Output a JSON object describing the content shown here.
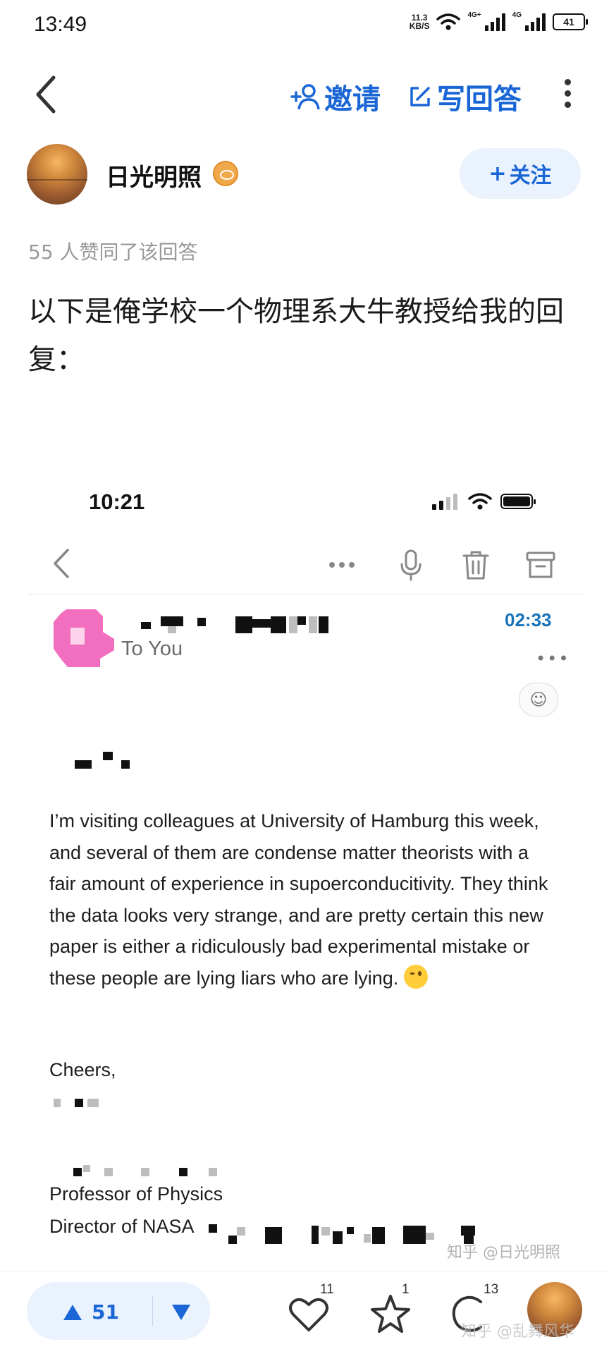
{
  "status_bar": {
    "time": "13:49",
    "net_speed": "11.3",
    "net_unit": "KB/S",
    "sig1": "4G+",
    "sig2": "4G",
    "battery": "41"
  },
  "header": {
    "invite_label": "邀请",
    "write_answer_label": "写回答"
  },
  "author": {
    "name": "日光明照",
    "follow_label": "关注"
  },
  "answer": {
    "likes_text": "55 人赞同了该回答",
    "intro_text": "以下是俺学校一个物理系大牛教授给我的回复："
  },
  "email": {
    "status_time": "10:21",
    "to_label": "To You",
    "timestamp": "02:33",
    "more_dots": "•••",
    "body": "I’m visiting colleagues at University of Hamburg this week, and several of them are condense matter theorists with a fair amount of experience in supoerconducitivity. They think the data looks very strange, and are pretty certain this new paper is either a ridiculously bad experimental mistake or these people are lying liars who are lying.",
    "closing": "Cheers,",
    "title_line": "Professor of Physics",
    "director_line": "Director of NASA"
  },
  "watermarks": {
    "first": "知乎 @日光明照",
    "second": "知乎 @乱舞风华"
  },
  "actions": {
    "upvote_count": "51",
    "like_count": "11",
    "star_count": "1",
    "comment_count": "13"
  },
  "colors": {
    "accent": "#1a66d6",
    "pill_bg": "#eaf2fd",
    "timestamp": "#1a73b8"
  },
  "icons": [
    "back-icon",
    "add-user-icon",
    "edit-icon",
    "more-icon",
    "eye-badge-icon",
    "wifi-icon",
    "signal-icon",
    "battery-icon",
    "mic-icon",
    "trash-icon",
    "archive-icon",
    "emoji-icon",
    "upvote-icon",
    "downvote-icon",
    "heart-icon",
    "star-icon",
    "comment-icon"
  ]
}
